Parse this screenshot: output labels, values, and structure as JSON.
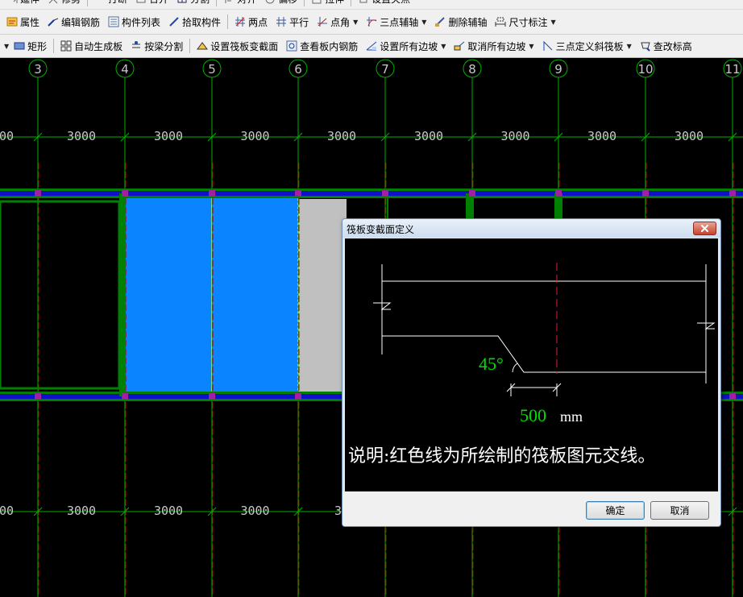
{
  "toolbar_top": {
    "items": [
      {
        "label": "延伸",
        "icon": "extend-icon"
      },
      {
        "label": "修剪",
        "icon": "trim-icon"
      },
      {
        "label": "打断",
        "icon": "break-icon"
      },
      {
        "label": "合并",
        "icon": "merge-icon"
      },
      {
        "label": "分割",
        "icon": "split-icon"
      },
      {
        "label": "对齐",
        "icon": "align-icon"
      },
      {
        "label": "偏移",
        "icon": "offset-icon"
      },
      {
        "label": "拉伸",
        "icon": "stretch-icon"
      },
      {
        "label": "设置夹点",
        "icon": "grip-icon"
      }
    ]
  },
  "toolbar1": {
    "items": [
      {
        "label": "属性",
        "icon": "properties-icon",
        "dropdown": false
      },
      {
        "label": "编辑钢筋",
        "icon": "edit-rebar-icon",
        "dropdown": false
      },
      {
        "label": "构件列表",
        "icon": "component-list-icon",
        "dropdown": false
      },
      {
        "label": "拾取构件",
        "icon": "pick-component-icon",
        "dropdown": false
      },
      {
        "label": "两点",
        "icon": "two-point-axis-icon",
        "dropdown": false
      },
      {
        "label": "平行",
        "icon": "parallel-axis-icon",
        "dropdown": false
      },
      {
        "label": "点角",
        "icon": "point-angle-icon",
        "dropdown": true
      },
      {
        "label": "三点辅轴",
        "icon": "three-point-axis-icon",
        "dropdown": true
      },
      {
        "label": "删除辅轴",
        "icon": "delete-axis-icon",
        "dropdown": false
      },
      {
        "label": "尺寸标注",
        "icon": "dimension-icon",
        "dropdown": true
      }
    ]
  },
  "toolbar2": {
    "items": [
      {
        "label": "矩形",
        "icon": "rectangle-icon",
        "dropdown": false
      },
      {
        "label": "自动生成板",
        "icon": "auto-slab-icon",
        "dropdown": false
      },
      {
        "label": "按梁分割",
        "icon": "split-by-beam-icon",
        "dropdown": false
      },
      {
        "label": "设置筏板变截面",
        "icon": "raft-section-icon",
        "dropdown": false
      },
      {
        "label": "查看板内钢筋",
        "icon": "view-rebar-icon",
        "dropdown": false
      },
      {
        "label": "设置所有边坡",
        "icon": "set-slope-icon",
        "dropdown": true
      },
      {
        "label": "取消所有边坡",
        "icon": "cancel-slope-icon",
        "dropdown": true
      },
      {
        "label": "三点定义斜筏板",
        "icon": "inclined-raft-icon",
        "dropdown": true
      },
      {
        "label": "查改标高",
        "icon": "elevation-icon",
        "dropdown": false
      }
    ]
  },
  "drawing": {
    "axes": [
      "3",
      "4",
      "5",
      "6",
      "7",
      "8",
      "9",
      "10",
      "11"
    ],
    "dimensions_top": [
      "00",
      "3000",
      "3000",
      "3000",
      "3000",
      "3000",
      "3000",
      "3000",
      "3000"
    ],
    "dimensions_bottom": [
      "00",
      "3000",
      "3000",
      "3000",
      "30"
    ]
  },
  "dialog": {
    "title": "筏板变截面定义",
    "angle_label": "45°",
    "width_value": "500",
    "unit": "mm",
    "note": "说明:红色线为所绘制的筏板图元交线。",
    "ok_label": "确定",
    "cancel_label": "取消"
  },
  "colors": {
    "canvas_bg": "#000000",
    "axis_line": "#00b000",
    "axis_center_red": "#b00000",
    "beam_blue": "#1010c8",
    "beam_green": "#008000",
    "slab_selected": "#0a84ff",
    "slab_gray": "#c0c0c0",
    "dim_text": "#c8c8c8",
    "dialog_green_text": "#00e000",
    "dialog_red_line": "#e0202a"
  }
}
